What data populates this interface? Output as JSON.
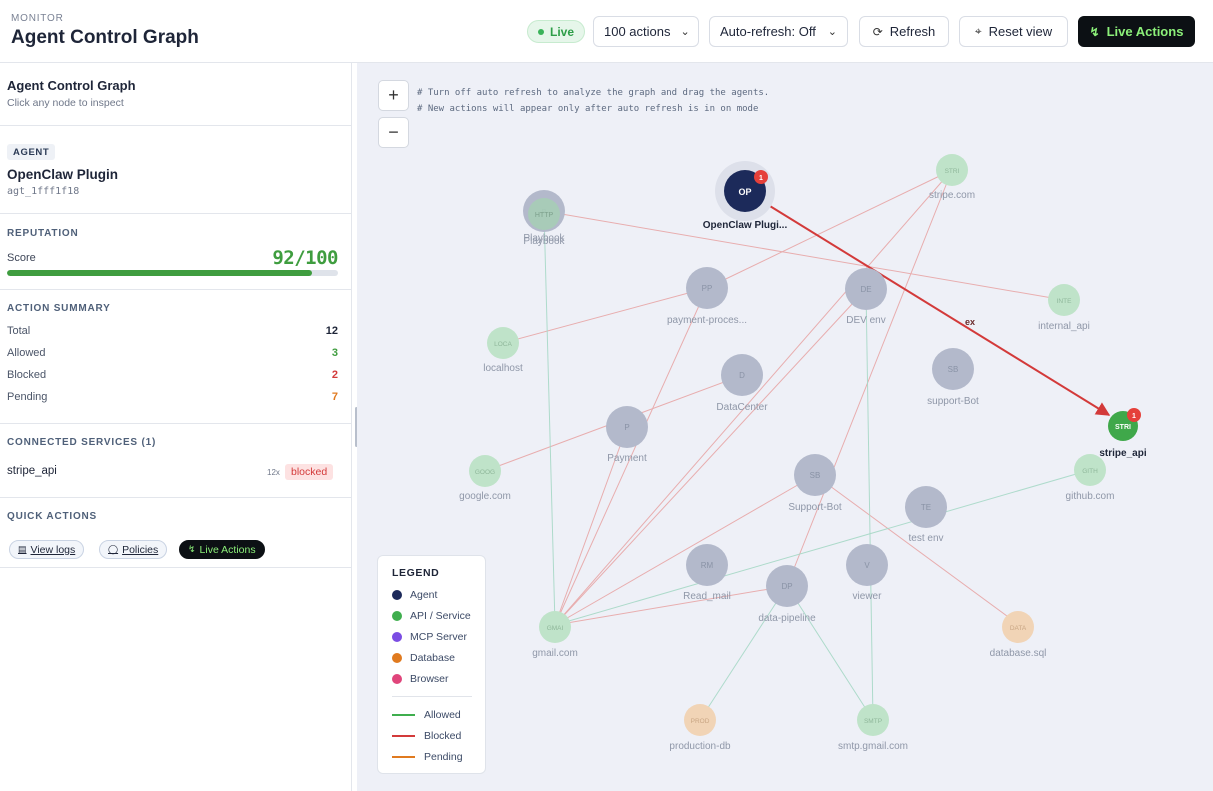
{
  "header": {
    "eyebrow": "MONITOR",
    "title": "Agent Control Graph",
    "live_label": "Live",
    "actions_select": "100 actions",
    "refresh_select": "Auto-refresh: Off",
    "refresh_button": "Refresh",
    "reset_button": "Reset view",
    "live_actions_button": "Live Actions"
  },
  "sidebar": {
    "title": "Agent Control Graph",
    "subtitle": "Click any node to inspect",
    "agent": {
      "badge": "AGENT",
      "name": "OpenClaw Plugin",
      "id": "agt_1fff1f18"
    },
    "reputation": {
      "label": "REPUTATION",
      "score_label": "Score",
      "score_text": "92/100",
      "score_fraction": 0.92
    },
    "summary": {
      "label": "ACTION SUMMARY",
      "rows": [
        {
          "label": "Total",
          "value": "12",
          "color": "#1e2538"
        },
        {
          "label": "Allowed",
          "value": "3",
          "color": "#3f9d3f"
        },
        {
          "label": "Blocked",
          "value": "2",
          "color": "#d33a3a"
        },
        {
          "label": "Pending",
          "value": "7",
          "color": "#e07a1f"
        }
      ]
    },
    "services": {
      "label": "CONNECTED SERVICES (1)",
      "name": "stripe_api",
      "count": "12x",
      "status": "blocked"
    },
    "quick": {
      "label": "QUICK ACTIONS",
      "view_logs": "View logs",
      "policies": "Policies",
      "live_actions": "Live Actions"
    }
  },
  "canvas": {
    "zoom_in": "+",
    "zoom_out": "−",
    "hint_1": "# Turn off auto refresh to analyze the graph and drag the agents.",
    "hint_2": "# New actions will appear only after auto refresh is in on mode",
    "edge_label": "ex",
    "legend": {
      "title": "LEGEND",
      "items": [
        {
          "label": "Agent",
          "color": "#1c2a5a"
        },
        {
          "label": "API / Service",
          "color": "#3fae4e"
        },
        {
          "label": "MCP Server",
          "color": "#7b4de3"
        },
        {
          "label": "Database",
          "color": "#e07a1f"
        },
        {
          "label": "Browser",
          "color": "#e0457b"
        }
      ],
      "lines": [
        {
          "label": "Allowed",
          "color": "#3fae4e"
        },
        {
          "label": "Blocked",
          "color": "#d33a3a"
        },
        {
          "label": "Pending",
          "color": "#e07a1f"
        }
      ]
    },
    "nodes": {
      "agent": {
        "abbr": "OP",
        "label": "OpenClaw Plugi...",
        "badge": "1"
      },
      "stripe_api": {
        "abbr": "STRI",
        "label": "stripe_api",
        "badge": "1"
      },
      "http": {
        "abbr": "HTTP",
        "label": "Playbook"
      },
      "p_back": {
        "abbr": "P",
        "label": "Playbook"
      },
      "stripe_com": {
        "abbr": "STRI",
        "label": "stripe.com"
      },
      "pp": {
        "abbr": "PP",
        "label": "payment-proces..."
      },
      "de": {
        "abbr": "DE",
        "label": "DEV env"
      },
      "inte": {
        "abbr": "INTE",
        "label": "internal_api"
      },
      "loca": {
        "abbr": "LOCA",
        "label": "localhost"
      },
      "d": {
        "abbr": "D",
        "label": "DataCenter"
      },
      "sb": {
        "abbr": "SB",
        "label": "support-Bot"
      },
      "p": {
        "abbr": "P",
        "label": "Payment"
      },
      "goog": {
        "abbr": "GOOG",
        "label": "google.com"
      },
      "sb2": {
        "abbr": "SB",
        "label": "Support-Bot"
      },
      "gith": {
        "abbr": "GITH",
        "label": "github.com"
      },
      "te": {
        "abbr": "TE",
        "label": "test env"
      },
      "rm": {
        "abbr": "RM",
        "label": "Read_mail"
      },
      "v": {
        "abbr": "V",
        "label": "viewer"
      },
      "dp": {
        "abbr": "DP",
        "label": "data-pipeline"
      },
      "gmai": {
        "abbr": "GMAI",
        "label": "gmail.com"
      },
      "data": {
        "abbr": "DATA",
        "label": "database.sql"
      },
      "prod": {
        "abbr": "PROD",
        "label": "production-db"
      },
      "smtp": {
        "abbr": "SMTP",
        "label": "smtp.gmail.com"
      }
    }
  }
}
